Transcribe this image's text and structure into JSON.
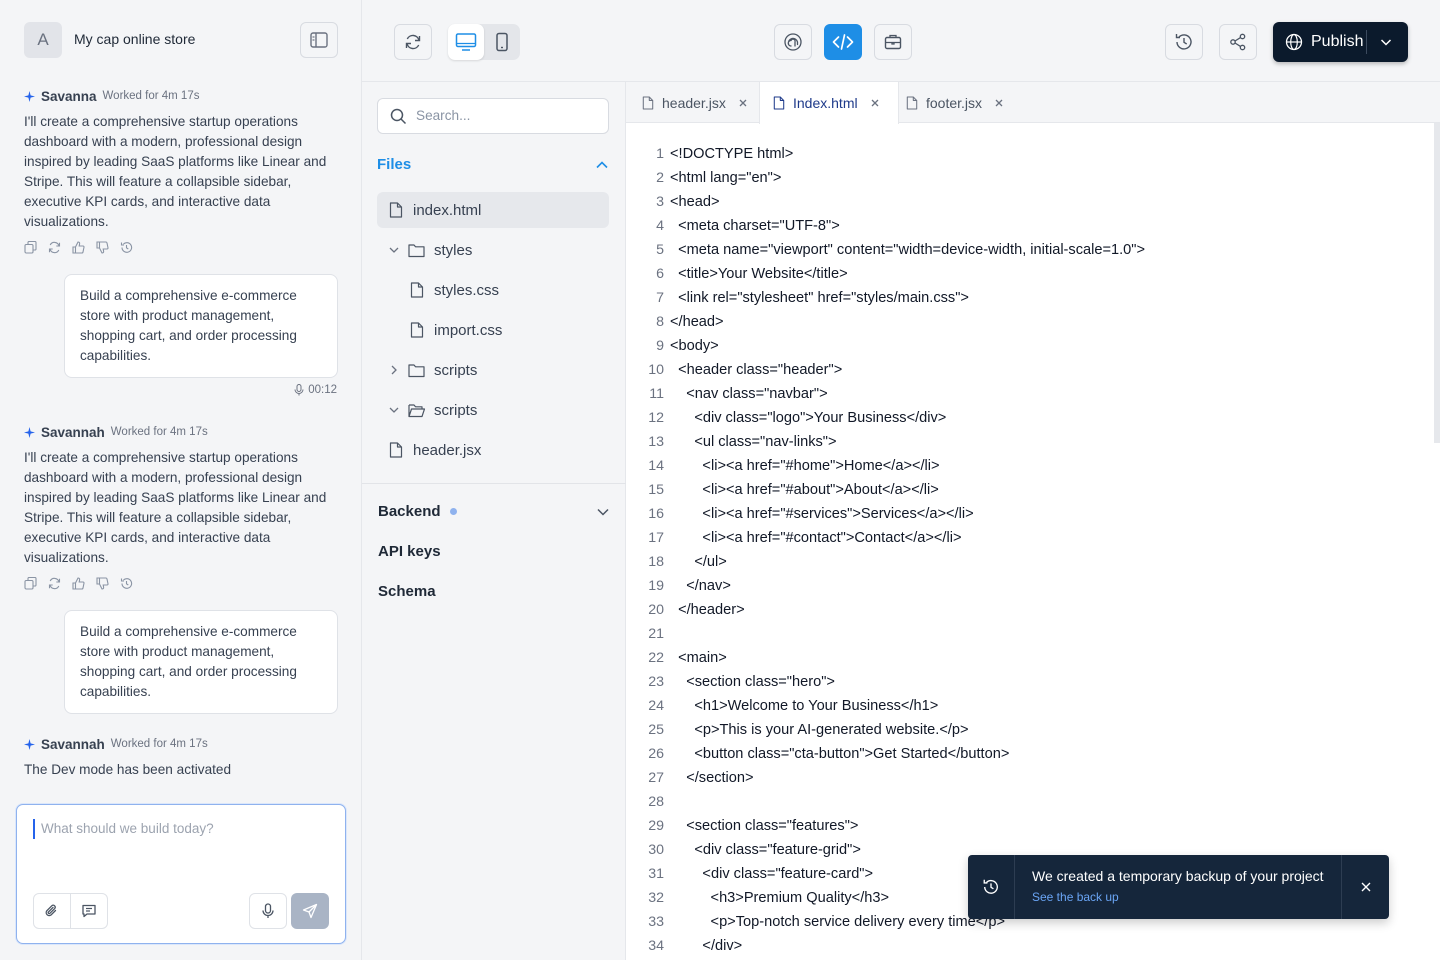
{
  "header": {
    "avatar_letter": "A",
    "store_name": "My cap online store"
  },
  "chat": {
    "messages": [
      {
        "agent": "Savanna",
        "worked": "Worked for 4m 17s",
        "text": "I'll create a comprehensive startup operations dashboard with a modern, professional design inspired by leading SaaS platforms like Linear and Stripe. This will feature a collapsible sidebar, executive KPI cards, and interactive data visualizations."
      },
      {
        "user": "Build a comprehensive e-commerce store with product management, shopping cart, and order processing capabilities.",
        "voice": "00:12"
      },
      {
        "agent": "Savannah",
        "worked": "Worked for 4m 17s",
        "text": "I'll create a comprehensive startup operations dashboard with a modern, professional design inspired by leading SaaS platforms like Linear and Stripe. This will feature a collapsible sidebar, executive KPI cards, and interactive data visualizations."
      },
      {
        "user": "Build a comprehensive e-commerce store with product management, shopping cart, and order processing capabilities."
      },
      {
        "agent": "Savannah",
        "worked": "Worked for 4m 17s",
        "text": "The Dev mode has been activated"
      }
    ],
    "composer_placeholder": "What should we build today?"
  },
  "toolbar": {
    "publish_label": "Publish"
  },
  "explorer": {
    "search_placeholder": "Search...",
    "files_title": "Files",
    "items": [
      "index.html",
      "styles",
      "styles.css",
      "import.css",
      "scripts",
      "scripts",
      "header.jsx"
    ],
    "backend_title": "Backend",
    "api_keys": "API keys",
    "schema": "Schema"
  },
  "editor": {
    "tabs": [
      "header.jsx",
      "Index.html",
      "footer.jsx"
    ],
    "active_tab": "Index.html",
    "lines": [
      "<!DOCTYPE html>",
      "<html lang=\"en\">",
      "<head>",
      "  <meta charset=\"UTF-8\">",
      "  <meta name=\"viewport\" content=\"width=device-width, initial-scale=1.0\">",
      "  <title>Your Website</title>",
      "  <link rel=\"stylesheet\" href=\"styles/main.css\">",
      "</head>",
      "<body>",
      "  <header class=\"header\">",
      "    <nav class=\"navbar\">",
      "      <div class=\"logo\">Your Business</div>",
      "      <ul class=\"nav-links\">",
      "        <li><a href=\"#home\">Home</a></li>",
      "        <li><a href=\"#about\">About</a></li>",
      "        <li><a href=\"#services\">Services</a></li>",
      "        <li><a href=\"#contact\">Contact</a></li>",
      "      </ul>",
      "    </nav>",
      "  </header>",
      "",
      "  <main>",
      "    <section class=\"hero\">",
      "      <h1>Welcome to Your Business</h1>",
      "      <p>This is your AI-generated website.</p>",
      "      <button class=\"cta-button\">Get Started</button>",
      "    </section>",
      "",
      "    <section class=\"features\">",
      "      <div class=\"feature-grid\">",
      "        <div class=\"feature-card\">",
      "          <h3>Premium Quality</h3>",
      "          <p>Top-notch service delivery every time</p>",
      "        </div>"
    ]
  },
  "toast": {
    "message": "We created a temporary backup of your project",
    "link": "See the back up"
  },
  "colors": {
    "accent": "#1e8ee6",
    "publish_bg": "#0b1a2c",
    "toast_bg": "#15263b"
  }
}
